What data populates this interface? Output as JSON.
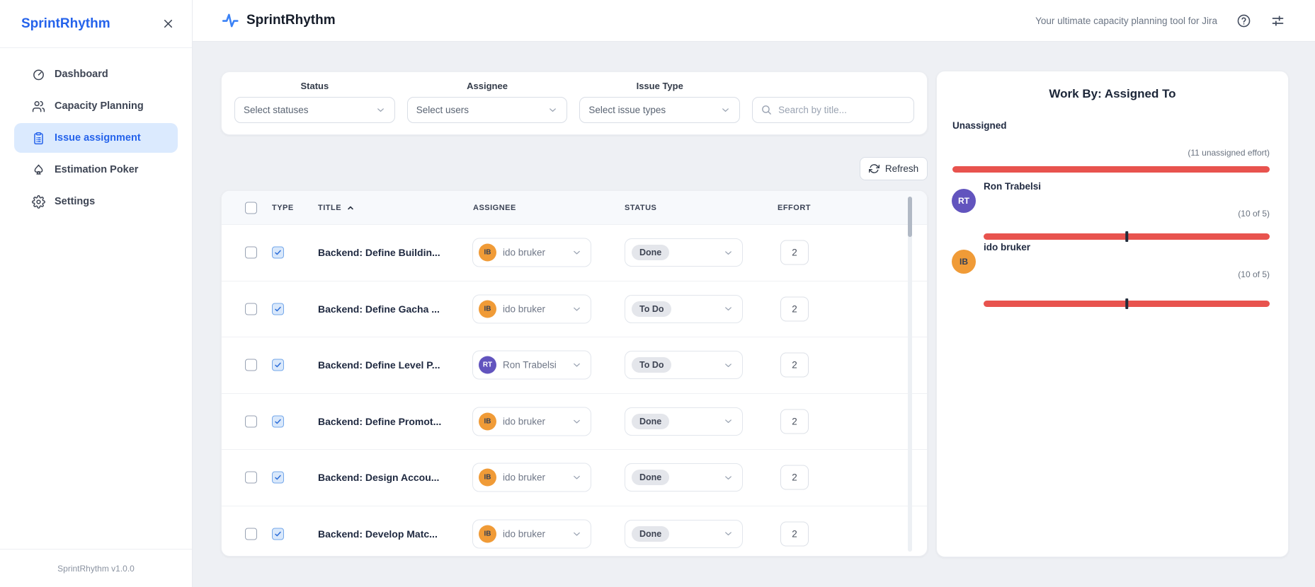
{
  "header": {
    "app_name": "SprintRhythm",
    "tagline": "Your ultimate capacity planning tool for Jira"
  },
  "sidebar": {
    "title": "SprintRhythm",
    "items": [
      {
        "label": "Dashboard"
      },
      {
        "label": "Capacity Planning"
      },
      {
        "label": "Issue assignment"
      },
      {
        "label": "Estimation Poker"
      },
      {
        "label": "Settings"
      }
    ],
    "footer": "SprintRhythm v1.0.0"
  },
  "filters": {
    "status_label": "Status",
    "status_value": "Select statuses",
    "assignee_label": "Assignee",
    "assignee_value": "Select users",
    "issue_type_label": "Issue Type",
    "issue_type_value": "Select issue types",
    "search_placeholder": "Search by title..."
  },
  "toolbar": {
    "refresh_label": "Refresh"
  },
  "table": {
    "columns": {
      "type": "TYPE",
      "title": "TITLE",
      "assignee": "ASSIGNEE",
      "status": "STATUS",
      "effort": "EFFORT"
    },
    "rows": [
      {
        "title": "Backend: Define Buildin...",
        "assignee": {
          "name": "ido bruker",
          "initials": "IB",
          "color": "#F09B37",
          "text_color": "#333F55"
        },
        "status": "Done",
        "effort": "2"
      },
      {
        "title": "Backend: Define Gacha ...",
        "assignee": {
          "name": "ido bruker",
          "initials": "IB",
          "color": "#F09B37",
          "text_color": "#333F55"
        },
        "status": "To Do",
        "effort": "2"
      },
      {
        "title": "Backend: Define Level P...",
        "assignee": {
          "name": "Ron Trabelsi",
          "initials": "RT",
          "color": "#6254BE",
          "text_color": "#FFFFFF"
        },
        "status": "To Do",
        "effort": "2"
      },
      {
        "title": "Backend: Define Promot...",
        "assignee": {
          "name": "ido bruker",
          "initials": "IB",
          "color": "#F09B37",
          "text_color": "#333F55"
        },
        "status": "Done",
        "effort": "2"
      },
      {
        "title": "Backend: Design Accou...",
        "assignee": {
          "name": "ido bruker",
          "initials": "IB",
          "color": "#F09B37",
          "text_color": "#333F55"
        },
        "status": "Done",
        "effort": "2"
      },
      {
        "title": "Backend: Develop Matc...",
        "assignee": {
          "name": "ido bruker",
          "initials": "IB",
          "color": "#F09B37",
          "text_color": "#333F55"
        },
        "status": "Done",
        "effort": "2"
      }
    ]
  },
  "work_by": {
    "title": "Work By: Assigned To",
    "bar_color": "#E8534E",
    "tick_color": "#222B3A",
    "entries": [
      {
        "name": "Unassigned",
        "caption": "(11 unassigned effort)"
      },
      {
        "name": "Ron Trabelsi",
        "initials": "RT",
        "avatar_color": "#6254BE",
        "avatar_text_color": "#FFFFFF",
        "caption": "(10 of 5)",
        "tick_percent": 50
      },
      {
        "name": "ido bruker",
        "initials": "IB",
        "avatar_color": "#F09B37",
        "avatar_text_color": "#333F55",
        "caption": "(10 of 5)",
        "tick_percent": 50
      }
    ]
  }
}
